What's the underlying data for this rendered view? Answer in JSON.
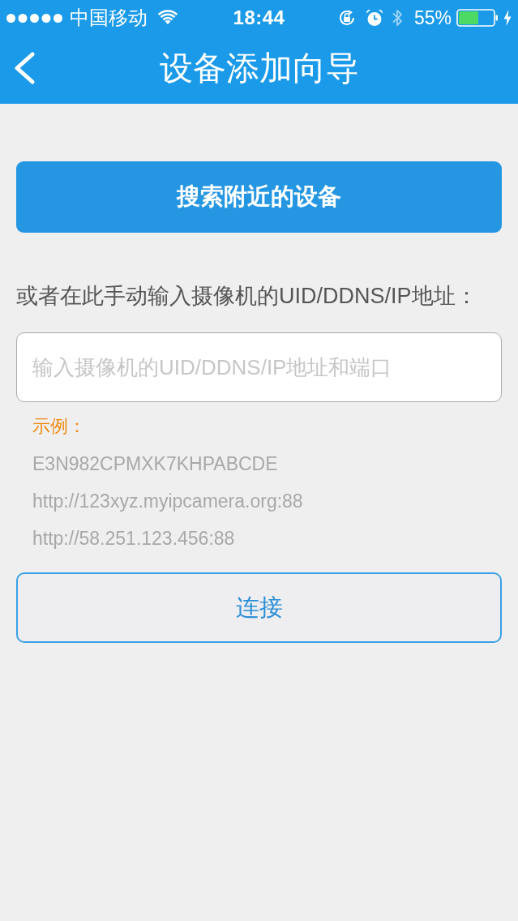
{
  "status_bar": {
    "carrier": "中国移动",
    "time": "18:44",
    "battery_percent": "55%"
  },
  "nav_bar": {
    "title": "设备添加向导"
  },
  "search_button": {
    "label": "搜索附近的设备"
  },
  "manual_entry": {
    "label": "或者在此手动输入摄像机的UID/DDNS/IP地址：",
    "input": {
      "placeholder": "输入摄像机的UID/DDNS/IP地址和端口"
    }
  },
  "examples": {
    "heading": "示例：",
    "items": [
      "E3N982CPMXK7KHPABCDE",
      "http://123xyz.myipcamera.org:88",
      "http://58.251.123.456:88"
    ]
  },
  "connect_button": {
    "label": "连接"
  }
}
